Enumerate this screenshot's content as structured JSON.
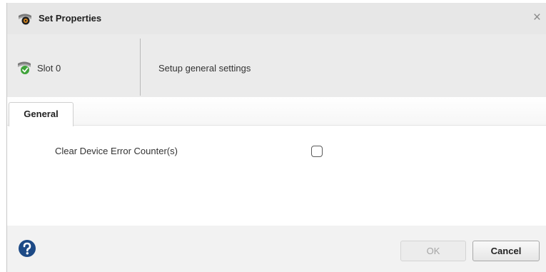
{
  "dialog": {
    "title": "Set Properties",
    "title_icon": "device-settings-icon",
    "close_glyph": "×"
  },
  "header": {
    "slot_label": "Slot 0",
    "slot_icon": "slot-status-ok-icon",
    "description": "Setup general settings"
  },
  "tabs": [
    {
      "label": "General",
      "selected": true
    }
  ],
  "general": {
    "clear_counters_label": "Clear Device Error Counter(s)",
    "clear_counters_checked": false
  },
  "footer": {
    "help_icon": "help-icon",
    "ok_label": "OK",
    "ok_enabled": false,
    "cancel_label": "Cancel"
  },
  "colors": {
    "title_bar": "#e7e7e7",
    "header_band": "#ebebeb",
    "footer": "#f2f2f2",
    "help_icon": "#1d4a86",
    "status_ok": "#3fa33a",
    "status_error": "#e08a1b"
  }
}
